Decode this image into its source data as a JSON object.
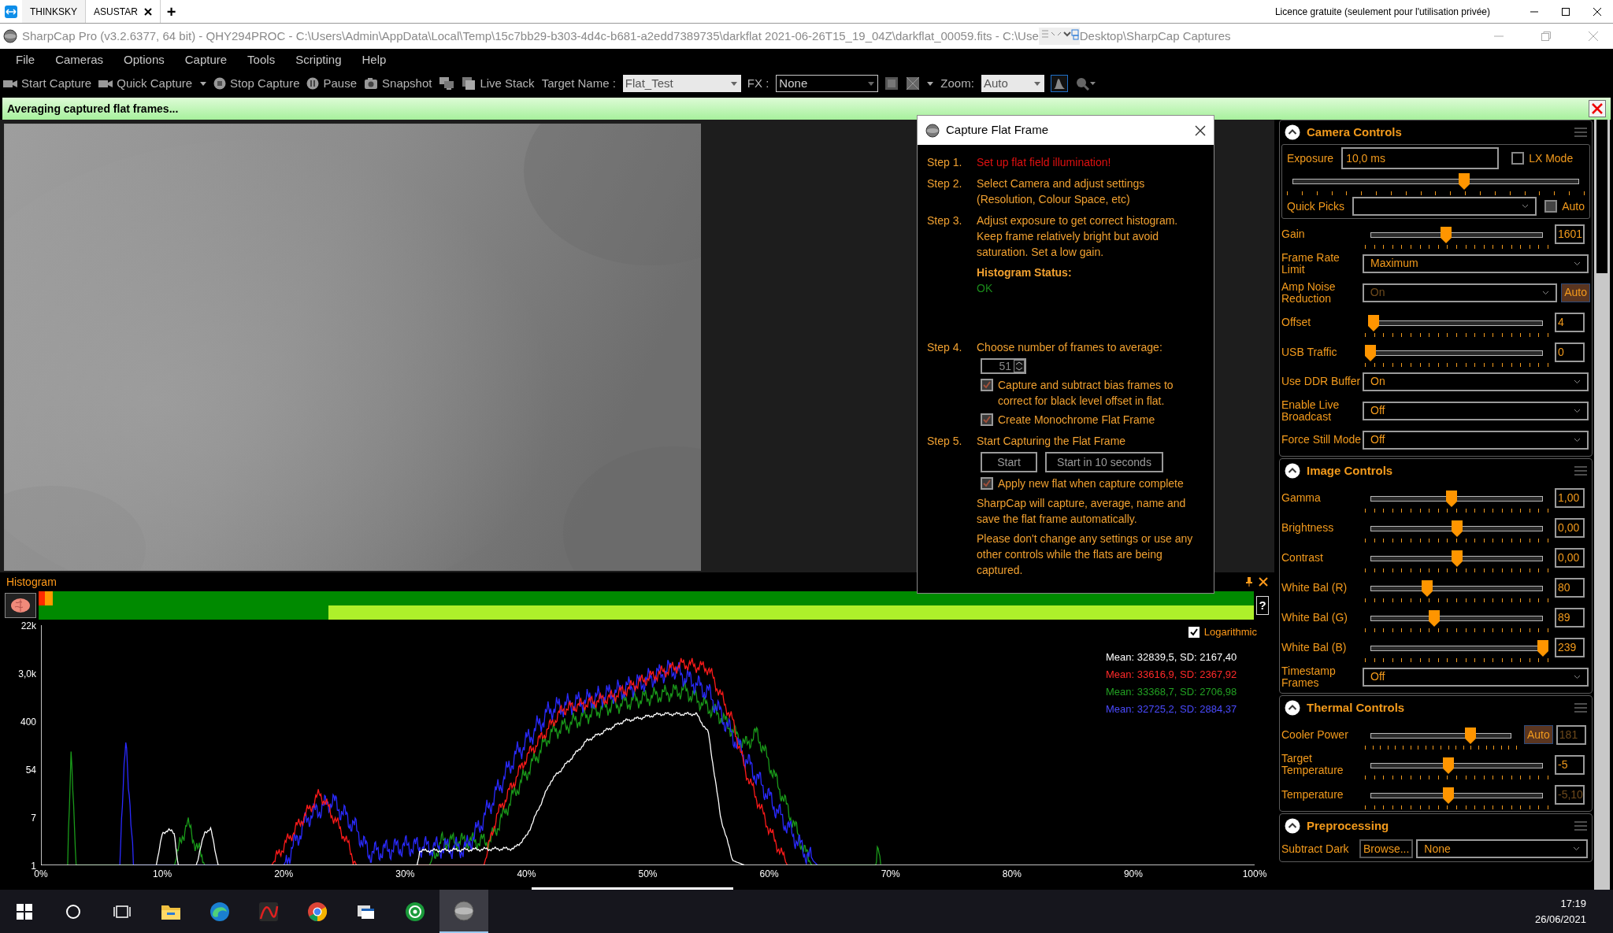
{
  "browser_tabs": [
    {
      "label": "THINKSKY",
      "selected": false,
      "closable": false
    },
    {
      "label": "ASUSTAR",
      "selected": true,
      "closable": true
    }
  ],
  "new_tab": "+",
  "licence": "Licence gratuite (seulement pour l'utilisation privée)",
  "window": {
    "title": "SharpCap Pro (v3.2.6377, 64 bit) - QHY294PROC - C:\\Users\\Admin\\AppData\\Local\\Temp\\15c7bb29-b303-4d4c-b681-a2edd7389735\\darkflat 2021-06-26T15_19_04Z\\darkflat_00059.fits - C:\\Use",
    "title_tail": "Desktop\\SharpCap Captures"
  },
  "menu": [
    "File",
    "Cameras",
    "Options",
    "Capture",
    "Tools",
    "Scripting",
    "Help"
  ],
  "toolbar": {
    "buttons": [
      {
        "kind": "camera",
        "label": "Start Capture",
        "dropdown": false
      },
      {
        "kind": "camera",
        "label": "Quick Capture",
        "dropdown": true
      },
      {
        "kind": "stop",
        "label": "Stop Capture",
        "dropdown": false
      },
      {
        "kind": "pause",
        "label": "Pause",
        "dropdown": false
      },
      {
        "kind": "snapshot",
        "label": "Snapshot",
        "dropdown": false
      },
      {
        "kind": "monitor",
        "dropdown": false
      },
      {
        "kind": "stack",
        "label": "Live Stack",
        "dropdown": false
      }
    ],
    "target_label": "Target Name :",
    "target_value": "Flat_Test",
    "fx_label": "FX :",
    "fx_value": "None",
    "zoom_label": "Zoom:",
    "zoom_value": "Auto"
  },
  "notification": "Averaging captured flat frames...",
  "dialog": {
    "title": "Capture Flat Frame",
    "steps": [
      {
        "kind": "plain",
        "label": "Step 1.",
        "text": "Set up flat field illumination!",
        "alert": true
      },
      {
        "kind": "plain",
        "label": "Step 2.",
        "text": "Select Camera and adjust settings (Resolution, Colour Space, etc)",
        "alert": false
      },
      {
        "kind": "status",
        "label": "Step 3.",
        "text": "Adjust exposure to get correct histogram. Keep frame relatively bright but avoid saturation. Set a low gain.",
        "alert": false,
        "status_label": "Histogram Status:",
        "status": "OK"
      },
      {
        "kind": "frames",
        "label": "Step 4.",
        "text": "Choose number of frames to average:",
        "alert": false,
        "frames": "51",
        "options": [
          {
            "label": "Capture and subtract bias frames to correct for black level offset in flat.",
            "checked": true
          },
          {
            "label": "Create Monochrome Flat Frame",
            "checked": true
          }
        ]
      },
      {
        "kind": "start",
        "label": "Step 5.",
        "text": "Start Capturing the Flat Frame",
        "alert": false,
        "buttons": [
          "Start",
          "Start in 10 seconds"
        ],
        "options": [
          {
            "label": "Apply new flat when capture complete",
            "checked": true
          }
        ]
      }
    ],
    "notes": [
      "SharpCap will capture, average, name and save the flat frame automatically.",
      "Please don't change any settings or use any other controls while the flats are being captured."
    ]
  },
  "histogram": {
    "title": "Histogram",
    "help": "?",
    "logarithmic": {
      "label": "Logarithmic",
      "checked": true
    },
    "y_labels": [
      "22k",
      "3,0k",
      "400",
      "54",
      "7",
      "1"
    ],
    "x_labels": [
      "0%",
      "10%",
      "20%",
      "30%",
      "40%",
      "50%",
      "60%",
      "70%",
      "80%",
      "90%",
      "100%"
    ],
    "stats": [
      {
        "text": "Mean: 32839,5, SD: 2167,40",
        "color": "#ffffff"
      },
      {
        "text": "Mean: 33616,9, SD: 2367,92",
        "color": "#ff2a2a"
      },
      {
        "text": "Mean: 33368,7, SD: 2706,98",
        "color": "#22a022"
      },
      {
        "text": "Mean: 32725,2, SD: 2884,37",
        "color": "#4a4aff"
      }
    ]
  },
  "panel": {
    "sections": [
      {
        "title": "Camera Controls",
        "rows": [
          {
            "kind": "exposure",
            "label": "Exposure",
            "value": "10,0 ms",
            "lx_label": "LX Mode",
            "lx_checked": false,
            "level": 0.6,
            "quick_label": "Quick Picks",
            "auto_label": "Auto",
            "auto_checked": false
          },
          {
            "kind": "slider",
            "label": "Gain",
            "level": 0.44,
            "value": "1601",
            "disabled": false
          },
          {
            "kind": "dropdown",
            "label": "Frame Rate Limit",
            "value": "Maximum",
            "disabled": false
          },
          {
            "kind": "dropdown",
            "label": "Amp Noise Reduction",
            "value": "On",
            "disabled": true,
            "auto": "Auto"
          },
          {
            "kind": "slider",
            "label": "Offset",
            "level": 0.02,
            "value": "4",
            "disabled": false
          },
          {
            "kind": "slider",
            "label": "USB Traffic",
            "level": 0,
            "value": "0",
            "disabled": false
          },
          {
            "kind": "dropdown",
            "label": "Use DDR Buffer",
            "value": "On",
            "disabled": false
          },
          {
            "kind": "dropdown",
            "label": "Enable Live Broadcast",
            "value": "Off",
            "disabled": false
          },
          {
            "kind": "dropdown",
            "label": "Force Still Mode",
            "value": "Off",
            "disabled": false
          }
        ]
      },
      {
        "title": "Image Controls",
        "rows": [
          {
            "kind": "slider",
            "label": "Gamma",
            "level": 0.47,
            "value": "1,00",
            "disabled": false
          },
          {
            "kind": "slider",
            "label": "Brightness",
            "level": 0.5,
            "value": "0,00",
            "disabled": false
          },
          {
            "kind": "slider",
            "label": "Contrast",
            "level": 0.5,
            "value": "0,00",
            "disabled": false
          },
          {
            "kind": "slider",
            "label": "White Bal (R)",
            "level": 0.33,
            "value": "80",
            "disabled": false
          },
          {
            "kind": "slider",
            "label": "White Bal (G)",
            "level": 0.37,
            "value": "89",
            "disabled": false
          },
          {
            "kind": "slider",
            "label": "White Bal (B)",
            "level": 1,
            "value": "239",
            "disabled": false
          },
          {
            "kind": "dropdown",
            "label": "Timestamp Frames",
            "value": "Off",
            "disabled": false
          }
        ]
      },
      {
        "title": "Thermal Controls",
        "rows": [
          {
            "kind": "slider",
            "label": "Cooler Power",
            "level": 0.71,
            "value": "181",
            "disabled": true,
            "auto": "Auto"
          },
          {
            "kind": "slider",
            "label": "Target Temperature",
            "level": 0.45,
            "value": "-5",
            "disabled": false
          },
          {
            "kind": "slider",
            "label": "Temperature",
            "level": 0.45,
            "value": "-5,10",
            "disabled": true
          }
        ]
      },
      {
        "title": "Preprocessing",
        "rows": [
          {
            "kind": "file",
            "label": "Subtract Dark",
            "button": "Browse...",
            "value": "None"
          }
        ]
      }
    ]
  },
  "taskbar": {
    "apps": [
      {
        "kind": "start",
        "selected": false
      },
      {
        "kind": "search",
        "selected": false
      },
      {
        "kind": "taskview",
        "selected": false
      },
      {
        "kind": "folder",
        "selected": false
      },
      {
        "kind": "edge",
        "selected": false
      },
      {
        "kind": "curve",
        "selected": false
      },
      {
        "kind": "chrome",
        "selected": false
      },
      {
        "kind": "window",
        "selected": false
      },
      {
        "kind": "target",
        "selected": false
      },
      {
        "kind": "sphere",
        "selected": true
      }
    ],
    "time": "17:19",
    "date": "26/06/2021"
  }
}
